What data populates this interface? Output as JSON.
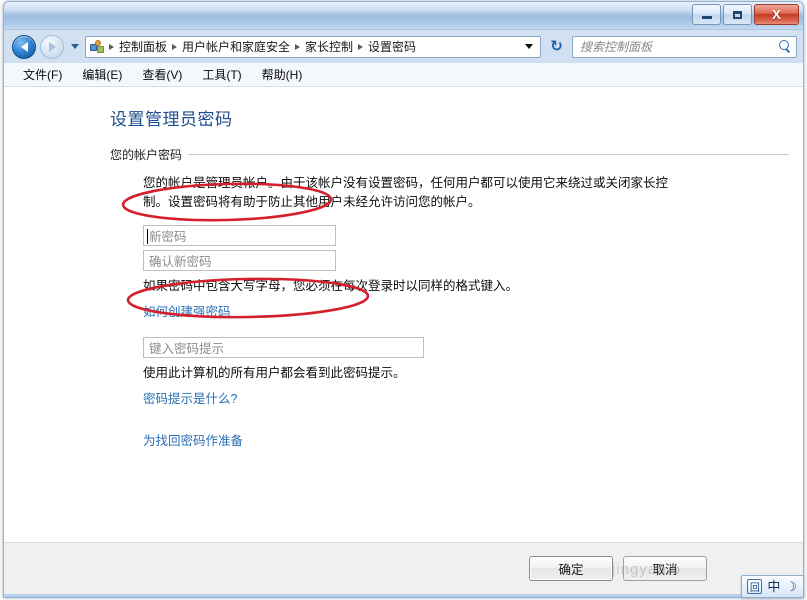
{
  "window": {
    "controls": {
      "minimize": "—",
      "maximize": "□",
      "close": "X"
    }
  },
  "navbar": {
    "breadcrumbs": [
      {
        "label": "控制面板"
      },
      {
        "label": "用户帐户和家庭安全"
      },
      {
        "label": "家长控制"
      },
      {
        "label": "设置密码"
      }
    ],
    "refresh_glyph": "↻",
    "search": {
      "placeholder": "搜索控制面板",
      "value": ""
    }
  },
  "menubar": {
    "items": [
      {
        "label": "文件(F)"
      },
      {
        "label": "编辑(E)"
      },
      {
        "label": "查看(V)"
      },
      {
        "label": "工具(T)"
      },
      {
        "label": "帮助(H)"
      }
    ]
  },
  "content": {
    "page_title": "设置管理员密码",
    "section_label": "您的帐户密码",
    "paragraph": "您的帐户是管理员帐户。由于该帐户没有设置密码，任何用户都可以使用它来绕过或关闭家长控制。设置密码将有助于防止其他用户未经允许访问您的帐户。",
    "new_password": {
      "placeholder": "新密码",
      "value": ""
    },
    "confirm_password": {
      "placeholder": "确认新密码",
      "value": ""
    },
    "caps_note": "如果密码中包含大写字母，您必须在每次登录时以同样的格式键入。",
    "strong_password_link": "如何创建强密码",
    "password_hint": {
      "placeholder": "键入密码提示",
      "value": ""
    },
    "hint_note": "使用此计算机的所有用户都会看到此密码提示。",
    "hint_help_link": "密码提示是什么?",
    "recovery_link": "为找回密码作准备"
  },
  "footer": {
    "ok_label": "确定",
    "cancel_label": "取消",
    "watermark": "jingyan.b"
  },
  "ime": {
    "input_icon": "回",
    "mode": "中",
    "moon": "☽"
  },
  "colors": {
    "title_link": "#1c4f8f",
    "hyperlink": "#2a6fb5",
    "annotation": "#d4202a",
    "close_button": "#c43c26"
  }
}
